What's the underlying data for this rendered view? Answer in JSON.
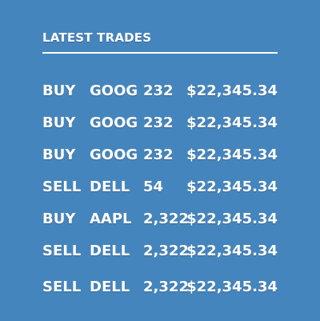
{
  "title": "LATEST TRADES",
  "trades": [
    {
      "side": "BUY",
      "symbol": "GOOG",
      "qty": "232",
      "amount": "$22,345.34"
    },
    {
      "side": "BUY",
      "symbol": "GOOG",
      "qty": "232",
      "amount": "$22,345.34"
    },
    {
      "side": "BUY",
      "symbol": "GOOG",
      "qty": "232",
      "amount": "$22,345.34"
    },
    {
      "side": "SELL",
      "symbol": "DELL",
      "qty": "54",
      "amount": "$22,345.34"
    },
    {
      "side": "BUY",
      "symbol": "AAPL",
      "qty": "2,322",
      "amount": "$22,345.34"
    },
    {
      "side": "SELL",
      "symbol": "DELL",
      "qty": "2,322",
      "amount": "$22,345.34"
    },
    {
      "side": "SELL",
      "symbol": "DELL",
      "qty": "2,322",
      "amount": "$22,345.34"
    }
  ]
}
